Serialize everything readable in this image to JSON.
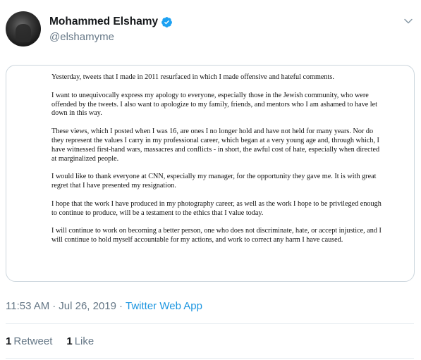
{
  "tweet": {
    "author": {
      "display_name": "Mohammed Elshamy",
      "handle": "@elshamyme",
      "verified_icon": "verified-badge-icon",
      "verified_color": "#1da1f2"
    },
    "menu_icon": "chevron-down-icon",
    "statement_paragraphs": [
      "Yesterday, tweets that I made in 2011 resurfaced in which I made offensive and hateful comments.",
      "I want to unequivocally express my apology to everyone, especially those in the Jewish community, who were offended by the tweets. I also want to apologize to my family, friends, and mentors who I am ashamed to have let down in this way.",
      "These views, which I posted when I was 16, are ones I no longer hold and have not held for many years. Nor do they represent the values I carry in my professional career, which began at a very young age and, through which, I have witnessed first-hand wars, massacres and conflicts - in short, the awful cost of hate, especially when directed at marginalized people.",
      "I would like to thank everyone at CNN, especially my manager, for the opportunity they gave me. It is with great regret that I have presented my resignation.",
      "I hope that the work I have produced in my photography career, as well as the work I hope to be privileged enough to continue to produce, will be a testament to the ethics that I value today.",
      "I will continue to work on becoming a better person, one who does not discriminate, hate, or accept injustice, and I will continue to hold myself accountable for my actions, and work to correct any harm I have caused."
    ],
    "timestamp": {
      "time": "11:53 AM",
      "separator1": "·",
      "date": "Jul 26, 2019",
      "separator2": "·",
      "source": "Twitter Web App",
      "source_color": "#1b95e0"
    },
    "stats": {
      "retweets_count": "1",
      "retweets_label": "Retweet",
      "likes_count": "1",
      "likes_label": "Like"
    }
  }
}
